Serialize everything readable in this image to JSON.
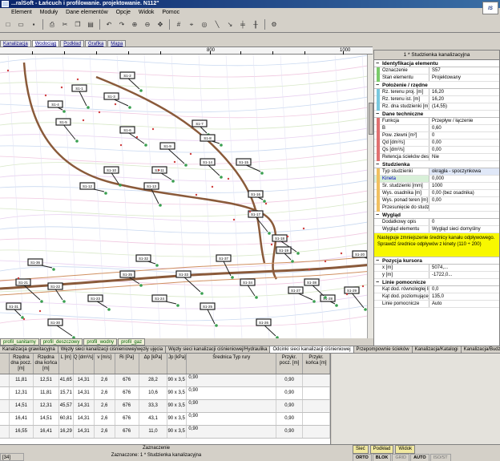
{
  "window": {
    "title": "...ralSoft - Łańcuch i profilowanie. projektowanie. N112\""
  },
  "menu": [
    "Element",
    "Moduły",
    "Dane elementów",
    "Opcje",
    "Widok",
    "Pomoc"
  ],
  "toolbar_icons": [
    "new-icon",
    "open-icon",
    "save-icon",
    "print-icon",
    "cut-icon",
    "copy-icon",
    "paste-icon",
    "undo-icon",
    "redo-icon",
    "zoom-in-icon",
    "zoom-out-icon",
    "pan-icon",
    "grid-icon",
    "snap-icon",
    "node-icon",
    "line-icon",
    "arrow-icon",
    "pipe-icon",
    "pipe2-icon",
    "network-icon"
  ],
  "doc_tabs": [
    "Kanalizacja",
    "Wodociąg",
    "Podkład",
    "Grafika",
    "Mapa"
  ],
  "ruler": {
    "marks": [
      "800",
      "1000"
    ]
  },
  "sheet_tabs": [
    "profil_sanitarny",
    "profil_deszczowy",
    "profil_wodny",
    "profil_gaz"
  ],
  "panel": {
    "title": "1 * Studzienka kanalizacyjna",
    "sections": [
      {
        "title": "Identyfikacja elementu",
        "color": "green",
        "rows": [
          [
            "Oznaczenie",
            "S57"
          ],
          [
            "Stan elementu",
            "Projektowany"
          ]
        ]
      },
      {
        "title": "Położenie / rzędne",
        "color": "cyan",
        "rows": [
          [
            "Rz. terenu proj. [m]",
            "16,20"
          ],
          [
            "Rz. terenu ist. [m]",
            "16,20"
          ],
          [
            "Rz. dna studzienki [m]",
            "(14,55)"
          ]
        ]
      },
      {
        "title": "Dane techniczne",
        "color": "red",
        "rows": [
          [
            "Funkcja",
            "Przepływ / łączenie"
          ],
          [
            "B",
            "0,60"
          ],
          [
            "Pow. zlewni [m²]",
            "0"
          ],
          [
            "Qd [dm³/s]",
            "0,00"
          ],
          [
            "Qs [dm³/s]",
            "0,00"
          ],
          [
            "Retencja ścieków deszczowych",
            "Nie"
          ]
        ]
      },
      {
        "title": "Studzienka",
        "color": "orange",
        "rows": [
          [
            "Typ studzienki",
            "okrągła - spoczynkowa"
          ],
          [
            "Kineta",
            "0,000"
          ],
          [
            "Śr. studzienki [mm]",
            "1000"
          ],
          [
            "Wys. osadnika [m]",
            "0,00 (bez osadnika)"
          ],
          [
            "Wys. ponad teren [m]",
            "0,00"
          ],
          [
            "Przesunięcie do studzienki [m³]",
            ""
          ]
        ]
      },
      {
        "title": "Wygląd",
        "color": "grey",
        "rows": [
          [
            "Dodatkowy opis",
            "0"
          ],
          [
            "Wygląd elementu",
            "Wygląd sieci domyślny"
          ]
        ]
      }
    ],
    "note": "Następuje zmniejszenie średnicy kanału odpływowego. Sprawdź średnice odpływów z kinety (110 ÷ 200)",
    "sections2": [
      {
        "title": "Pozycja kursora",
        "color": "grey",
        "rows": [
          [
            "x [m]",
            "5074,..."
          ],
          [
            "y [m]",
            "-1722,0..."
          ]
        ]
      },
      {
        "title": "Linie pomocnicze",
        "color": "grey",
        "rows": [
          [
            "Kąt dod. równoległej linii pomocniczej [°]",
            "0,0"
          ],
          [
            "Kąt dod. poziomującej linii pomocniczej [°]",
            "135,0"
          ],
          [
            "Linie pomocnicze",
            "Auto"
          ]
        ]
      }
    ]
  },
  "data_tabs": [
    "Kanalizacja grawitacyjna",
    "Węzły sieci kanalizacji ciśnieniowej/węzły ujęcia",
    "Węzły sieci kanalizacji ciśnieniowej/Hydraulika",
    "Odcinki sieci kanalizacji ciśnieniowej",
    "Przepompownie ścieków",
    "Kanalizacja/Katalogi",
    "Kanalizacja/Budżet"
  ],
  "table": {
    "headers": [
      "",
      "Rzędna dna pocz. [m]",
      "Rzędna dna końca [m]",
      "L [m]",
      "Q [dm³/s]",
      "v [m/s]",
      "Ri [Pa]",
      "Δp [kPa]",
      "Jp [kPa]",
      "Średnica Typ rury",
      "Przykr. pocz. [m]",
      "Przykr. końca [m]"
    ],
    "rows": [
      [
        "",
        "11,81",
        "12,51",
        "41,65",
        "14,31",
        "2,6",
        "676",
        "28,2",
        "90 x 3,5 PE80 SDR 17 (PN 8) w ciśnieniowej 3065262230",
        "0,90",
        "0,90"
      ],
      [
        "",
        "12,31",
        "11,81",
        "15,71",
        "14,31",
        "2,6",
        "676",
        "10,6",
        "90 x 3,5 PE80 SDR 17 (PN 8) w ciśnieniowej 3065262230",
        "0,90",
        "0,90"
      ],
      [
        "",
        "14,51",
        "12,31",
        "45,57",
        "14,31",
        "2,6",
        "676",
        "33,3",
        "90 x 3,5 PE80 SDR 17 (PN 8) w ciśnieniowej 3065262230",
        "0,90",
        "0,90"
      ],
      [
        "",
        "16,41",
        "14,51",
        "60,81",
        "14,31",
        "2,6",
        "676",
        "43,1",
        "90 x 3,5 PE80 SDR 17 (PN 8) w ciśnieniowej 3065262230",
        "0,90",
        "0,90"
      ],
      [
        "",
        "16,55",
        "16,41",
        "16,29",
        "14,31",
        "2,6",
        "676",
        "11,0",
        "90 x 3,5 PE80 SDR 17 (PN 8) w ciśnieniowej 3065262230",
        "0,90",
        "0,90"
      ]
    ]
  },
  "status": {
    "left": "[34]",
    "center_top": "Zaznaczenie",
    "center_bottom": "Zaznaczone: 1 * Studzienka kanalizacyjna",
    "tabs": [
      "Sieć",
      "Podkład",
      "Widok"
    ],
    "modes": [
      "ORTO",
      "BLOK",
      "GRID",
      "AUTO",
      "ISO/ST"
    ]
  },
  "map_labels": [
    "S1-1",
    "S1-2",
    "S1-3",
    "S1-4",
    "S1-5",
    "S1-6",
    "S1-7",
    "S1-8",
    "S1-9",
    "S1-10",
    "S1-11",
    "S1-12",
    "S1-13",
    "S1-14",
    "S1-15",
    "S1-16",
    "S1-17",
    "S1-18",
    "S1-19",
    "S1-20",
    "S1-21",
    "S1-22",
    "S1-23",
    "S1-24",
    "S1-25",
    "S1-26",
    "S1-27",
    "S1-28",
    "S1-29",
    "S1-30",
    "S1-31",
    "S1-32",
    "S1-33",
    "S1-34",
    "S1-35",
    "S1-36",
    "S1-37",
    "S1-38"
  ],
  "colors": {
    "pipe": "#8a5a3a",
    "manhole": "#3aa050",
    "label_box": "#222222",
    "highlight": "#f8f800"
  }
}
